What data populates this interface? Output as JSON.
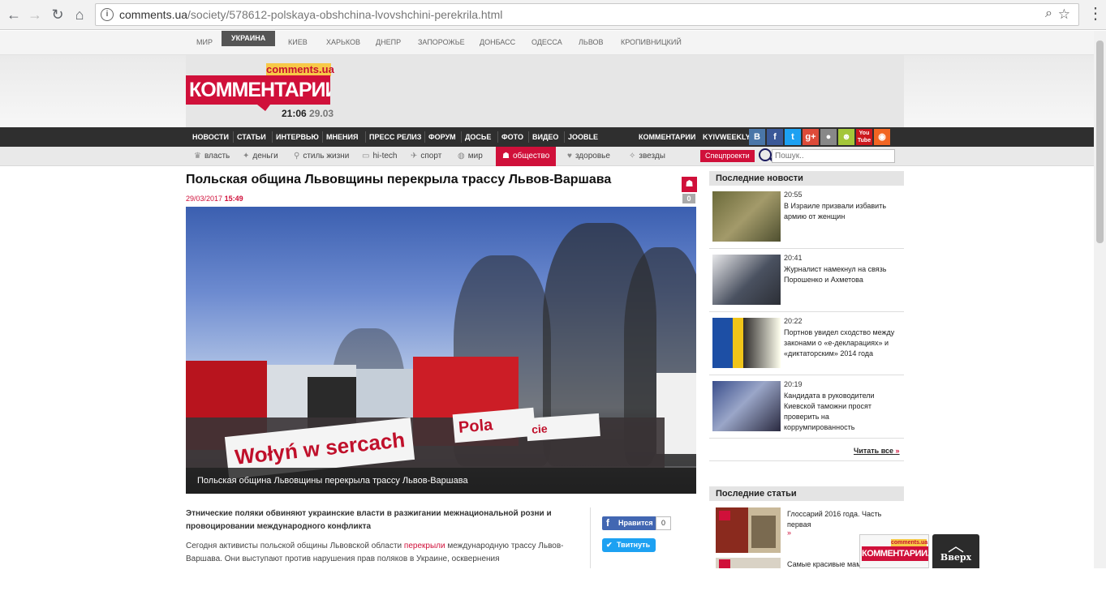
{
  "browser": {
    "url_host": "comments.ua",
    "url_path": "/society/578612-polskaya-obshchina-lvovshchini-perekrila.html"
  },
  "citybar": {
    "items": [
      "МИР",
      "УКРАИНА",
      "КИЕВ",
      "ХАРЬКОВ",
      "ДНЕПР",
      "ЗАПОРОЖЬЕ",
      "ДОНБАСС",
      "ОДЕССА",
      "ЛЬВОВ",
      "КРОПИВНИЦКИЙ"
    ],
    "active": "УКРАИНА"
  },
  "logo": {
    "small": "comments.ua",
    "main": "КОММЕНТАРИИ.UA",
    "time": "21:06",
    "date": "29.03"
  },
  "mainnav": {
    "items": [
      "НОВОСТИ",
      "СТАТЬИ",
      "ИНТЕРВЬЮ",
      "МНЕНИЯ",
      "ПРЕСС РЕЛИЗ",
      "ФОРУМ",
      "ДОСЬЕ",
      "ФОТО",
      "ВИДЕО",
      "JOOBLE"
    ],
    "right": [
      "КОММЕНТАРИИ",
      "KYIVWEEKLY"
    ],
    "social": [
      "B",
      "f",
      "t",
      "g+",
      "",
      "",
      "You Tube",
      ""
    ]
  },
  "subnav": {
    "items": [
      "власть",
      "деньги",
      "стиль жизни",
      "hi-tech",
      "спорт",
      "мир",
      "общество",
      "здоровье",
      "звезды"
    ],
    "active": "общество",
    "special": "Спецпроекти",
    "search_placeholder": "Пошук.."
  },
  "article": {
    "title": "Польская община Львовщины перекрыла трассу Львов-Варшава",
    "date": "29/03/2017",
    "time": "15:49",
    "comments": "0",
    "caption": "Польская община Львовщины перекрыла трассу Львов-Варшава",
    "banner_text": "Wołyń w sercach",
    "banner_text_2": "Pola",
    "banner_text_3": "cie",
    "lead": "Этнические поляки обвиняют украинские власти в разжигании межнациональной розни и провоцировании международного конфликта",
    "body_pre": "Сегодня активисты польской общины Львовской области ",
    "body_link": "перекрыли",
    "body_post": " международную трассу Львов-Варшава. Они выступают против нарушения прав поляков в Украине, осквернения"
  },
  "share": {
    "fb_label": "Нравится",
    "fb_count": "0",
    "tw_label": "Твитнуть"
  },
  "sidebar": {
    "news_title": "Последние новости",
    "news": [
      {
        "time": "20:55",
        "text": "В Израиле призвали избавить армию от женщин"
      },
      {
        "time": "20:41",
        "text": "Журналист намекнул на связь Порошенко и Ахметова"
      },
      {
        "time": "20:22",
        "text": "Портнов увидел сходство между законами о «е-декларациях» и «диктаторским» 2014 года"
      },
      {
        "time": "20:19",
        "text": "Кандидата в руководители Киевской таможни просят проверить на коррумпированность"
      }
    ],
    "read_all": "Читать все",
    "read_all_arrow": "»",
    "articles_title": "Последние статьи",
    "articles": [
      {
        "text": "Глоссарий 2016 года. Часть первая",
        "arrow": "»"
      },
      {
        "text": "Самые красивые мам",
        "arrow": ""
      }
    ]
  },
  "floating": {
    "logo_small": "comments.ua",
    "logo_main": "КОММЕНТАРИИ.UA",
    "up_label": "Вверх"
  }
}
